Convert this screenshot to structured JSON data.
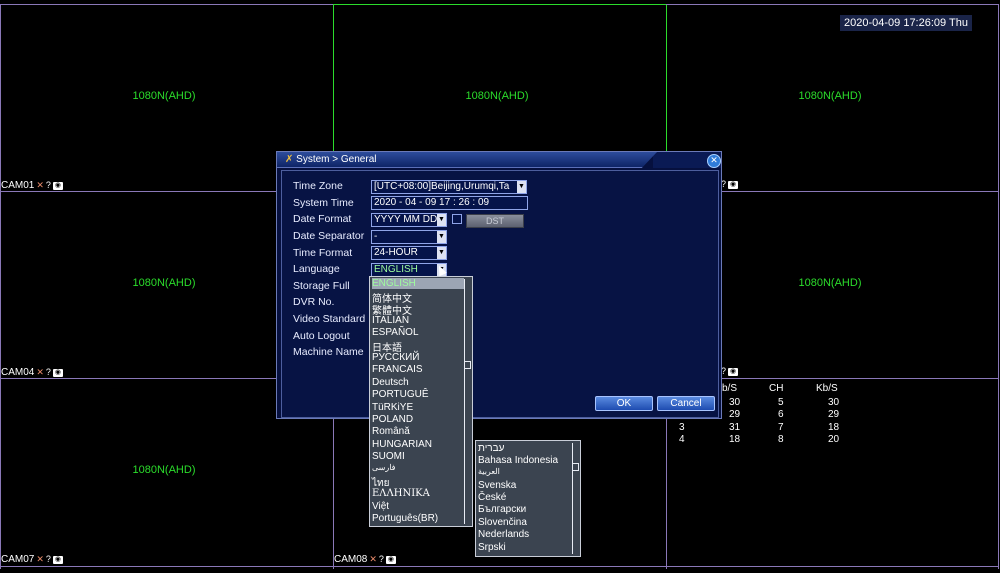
{
  "datetime": "2020-04-09 17:26:09 Thu",
  "cameras": [
    {
      "res": "1080N(AHD)"
    },
    {
      "res": "1080N(AHD)"
    },
    {
      "res": "1080N(AHD)"
    },
    {
      "res": "1080N(AHD)"
    },
    {
      "res": "1080N(AHD)"
    },
    {
      "res": "1080N(AHD)"
    },
    {
      "res": "1080N(AHD)"
    }
  ],
  "cam_labels": {
    "cam01": "CAM01",
    "cam04": "CAM04",
    "cam07": "CAM07",
    "cam08": "CAM08"
  },
  "dialog": {
    "title": "System > General",
    "labels": {
      "time_zone": "Time Zone",
      "system_time": "System Time",
      "date_format": "Date Format",
      "date_separator": "Date Separator",
      "time_format": "Time Format",
      "language": "Language",
      "storage_full": "Storage Full",
      "dvr_no": "DVR No.",
      "video_standard": "Video Standard",
      "auto_logout": "Auto Logout",
      "machine_name": "Machine Name"
    },
    "values": {
      "time_zone": "[UTC+08:00]Beijing,Urumqi,Ta",
      "system_time": "2020 - 04 - 09   17 : 26 : 09",
      "date_format": "YYYY MM DD",
      "date_separator": "-",
      "time_format": "24-HOUR",
      "language": "ENGLISH"
    },
    "dst_label": "DST",
    "ok_label": "OK",
    "cancel_label": "Cancel"
  },
  "language_options": [
    "ENGLISH",
    "简体中文",
    "繁體中文",
    "ITALIAN",
    "ESPAÑOL",
    "日本語",
    "РУССКИЙ",
    "FRANCAIS",
    "Deutsch",
    "PORTUGUÊ",
    "TüRKiYE",
    "POLAND",
    "Română",
    "HUNGARIAN",
    "SUOMI",
    "فارسی",
    "ไทย",
    "ΕΛΛΗΝΙΚΑ",
    "Việt",
    "Português(BR)"
  ],
  "language_options_2": [
    "עברית",
    "Bahasa Indonesia",
    "العربية",
    "Svenska",
    "České",
    "Български",
    "Slovenčina",
    "Nederlands",
    "Srpski"
  ],
  "stats": {
    "headers": [
      "b/S",
      "CH",
      "Kb/S"
    ],
    "rows": [
      [
        "",
        "30",
        "5",
        "30"
      ],
      [
        "",
        "29",
        "6",
        "29"
      ],
      [
        "3",
        "31",
        "7",
        "18"
      ],
      [
        "4",
        "18",
        "8",
        "20"
      ]
    ]
  },
  "colors": {
    "grid_purple": "#8a78b8",
    "grid_green": "#2bdc2b",
    "resolution_text": "#2bdc2b"
  }
}
